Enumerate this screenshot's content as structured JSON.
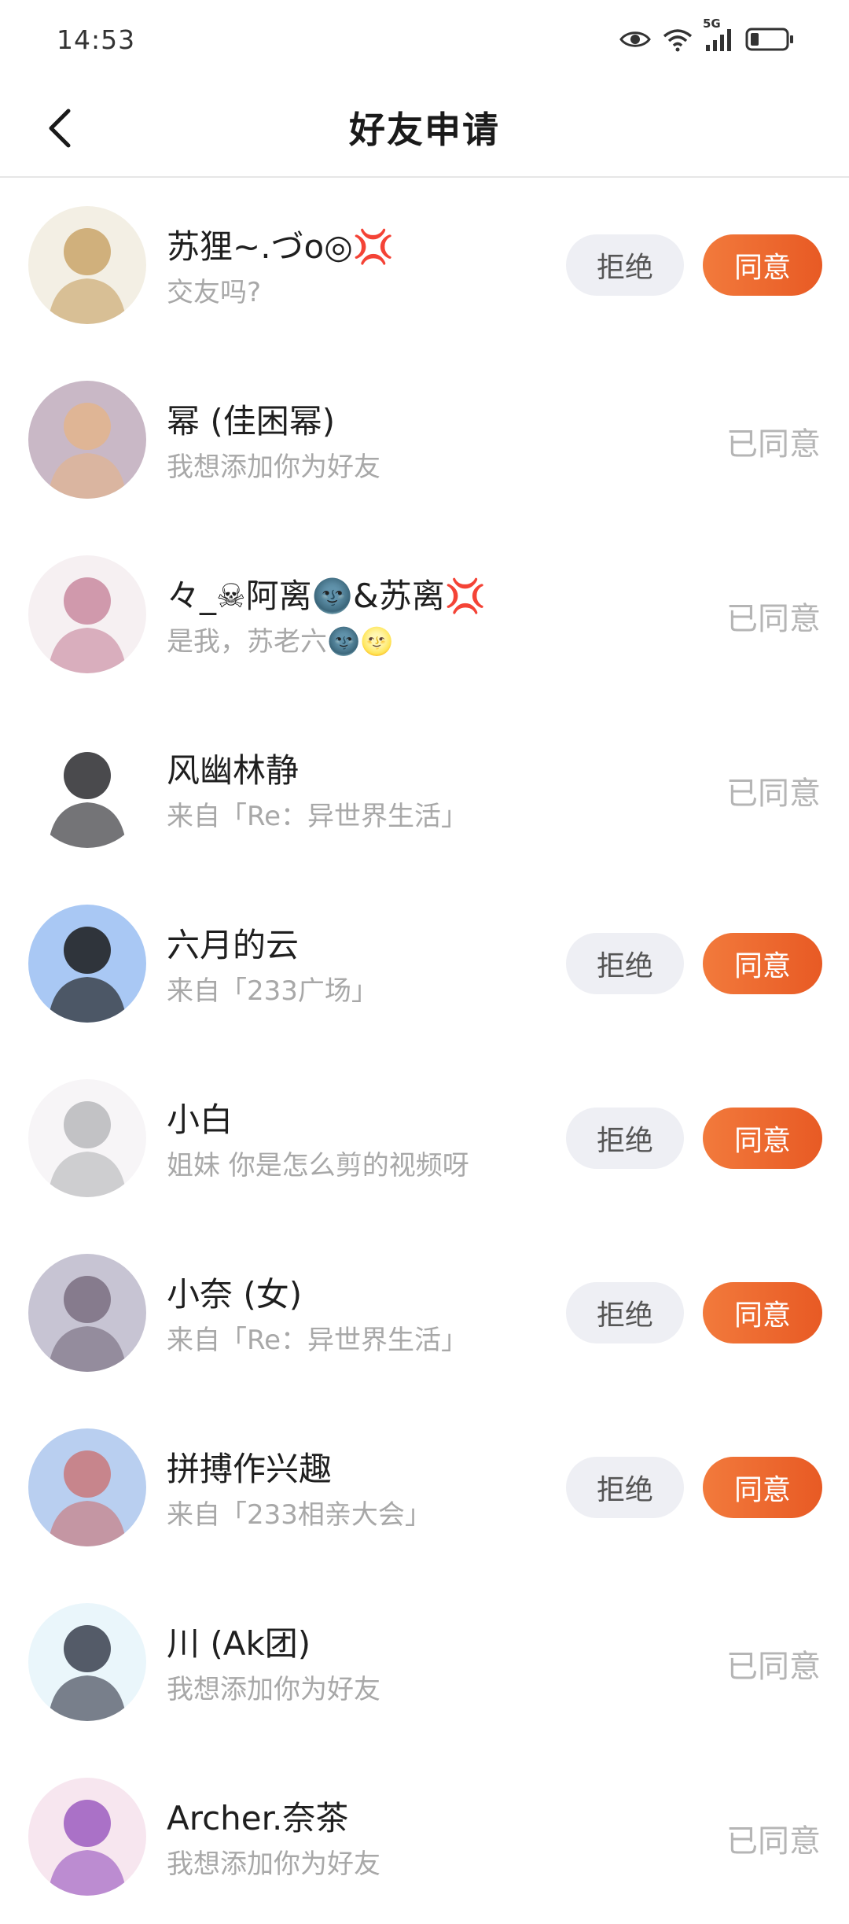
{
  "status_bar": {
    "time": "14:53",
    "network": "5G",
    "icons": [
      "eye-icon",
      "wifi-icon",
      "signal-icon",
      "battery-icon"
    ]
  },
  "header": {
    "title": "好友申请",
    "back_icon": "chevron-left-icon"
  },
  "colors": {
    "accent": "#ec6a2c",
    "reject_bg": "#eeeff4",
    "muted_text": "#a8a8a8"
  },
  "requests": [
    {
      "name": "苏狸~.づo◎💢",
      "message": "交友吗?",
      "state": "pending",
      "reject_label": "拒绝",
      "agree_label": "同意",
      "avatar": {
        "bg": "#f3efe4",
        "fg": "#c9a46a"
      }
    },
    {
      "name": "幂 (佳困幂)",
      "message": "我想添加你为好友",
      "state": "accepted",
      "status_label": "已同意",
      "avatar": {
        "bg": "#c9b8c6",
        "fg": "#e3b48c"
      }
    },
    {
      "name": "々_☠阿离🌚&苏离💢",
      "message": "是我，苏老六🌚🌝",
      "state": "accepted",
      "status_label": "已同意",
      "avatar": {
        "bg": "#f6f0f2",
        "fg": "#c98aa0"
      }
    },
    {
      "name": "风幽林静",
      "message": "来自「Re：异世界生活」",
      "state": "accepted",
      "status_label": "已同意",
      "avatar": {
        "bg": "#ffffff",
        "fg": "#2a2a2e"
      }
    },
    {
      "name": "六月的云",
      "message": "来自「233广场」",
      "state": "pending",
      "reject_label": "拒绝",
      "agree_label": "同意",
      "avatar": {
        "bg": "#a9c8f4",
        "fg": "#1a1a1a"
      }
    },
    {
      "name": "小白",
      "message": "姐妹 你是怎么剪的视频呀",
      "state": "pending",
      "reject_label": "拒绝",
      "agree_label": "同意",
      "avatar": {
        "bg": "#f7f5f7",
        "fg": "#b8b8bc"
      }
    },
    {
      "name": "小奈 (女)",
      "message": "来自「Re：异世界生活」",
      "state": "pending",
      "reject_label": "拒绝",
      "agree_label": "同意",
      "avatar": {
        "bg": "#c7c4d3",
        "fg": "#7a6e80"
      }
    },
    {
      "name": "拼搏作兴趣",
      "message": "来自「233相亲大会」",
      "state": "pending",
      "reject_label": "拒绝",
      "agree_label": "同意",
      "avatar": {
        "bg": "#b9cff0",
        "fg": "#c9787a"
      }
    },
    {
      "name": "川 (Ak团)",
      "message": "我想添加你为好友",
      "state": "accepted",
      "status_label": "已同意",
      "avatar": {
        "bg": "#eaf6fb",
        "fg": "#3a3f4e"
      }
    },
    {
      "name": "Archer.奈茶",
      "message": "我想添加你为好友",
      "state": "accepted",
      "status_label": "已同意",
      "avatar": {
        "bg": "#f7e6ef",
        "fg": "#9c5cc0"
      }
    }
  ]
}
